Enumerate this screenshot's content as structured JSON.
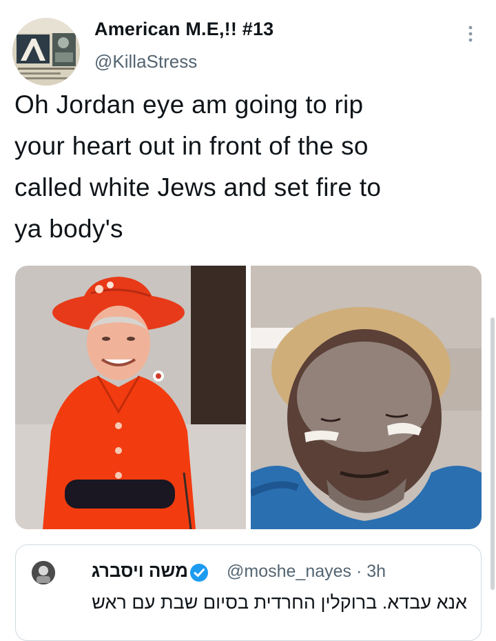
{
  "author": {
    "display_name": "American M.E,!! #13",
    "handle": "@KillaStress",
    "avatar_icon": "album-cover-avatar",
    "more_icon": "more-vertical-icon"
  },
  "tweet": {
    "lines": [
      "Oh Jordan eye am going to rip",
      "your heart out in front of the so",
      "called white Jews and set fire to",
      "ya body's"
    ]
  },
  "media": {
    "left_photo": "person-in-red-coat-and-red-hat-photo",
    "right_photo": "man-with-white-face-paint-photo"
  },
  "quote": {
    "name": "משה ויסברג",
    "handle": "@moshe_nayes",
    "separator": "·",
    "time": "3h",
    "text": "אנא עבדא. ברוקלין החרדית בסיום שבת עם ראש",
    "verified_color": "#1d9bf0"
  },
  "colors": {
    "text": "#0f1419",
    "secondary": "#536471",
    "border": "#cfd9de"
  }
}
